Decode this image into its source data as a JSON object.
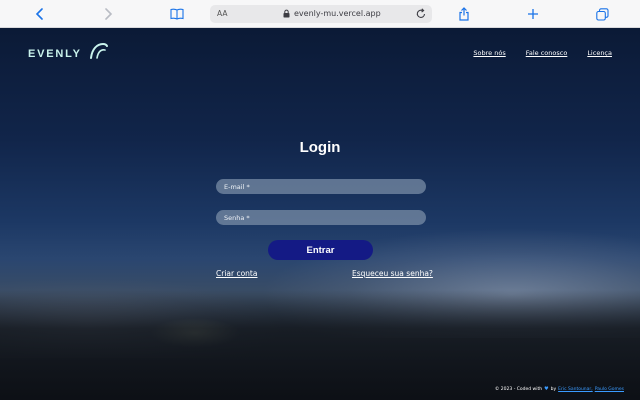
{
  "browser": {
    "reader_label": "AA",
    "url": "evenly-mu.vercel.app",
    "icons": [
      "back-icon",
      "forward-icon",
      "bookmarks-icon",
      "lock-icon",
      "reload-icon",
      "share-icon",
      "new-tab-icon",
      "tabs-icon"
    ],
    "accent": "#1a73e8"
  },
  "brand": {
    "name": "EVENLY",
    "color": "#c9f3ec"
  },
  "nav": {
    "items": [
      "Sobre nós",
      "Fale conosco",
      "Licença"
    ]
  },
  "login": {
    "title": "Login",
    "email_placeholder": "E-mail *",
    "password_placeholder": "Senha *",
    "submit_label": "Entrar",
    "create_account": "Criar conta",
    "forgot_password": "Esqueceu sua senha?",
    "button_color": "#141a85"
  },
  "footer": {
    "prefix": "© 2023 - Coded with",
    "by": "by",
    "author1": "Eric Santounar,",
    "author2": "Paulo Gomes"
  }
}
